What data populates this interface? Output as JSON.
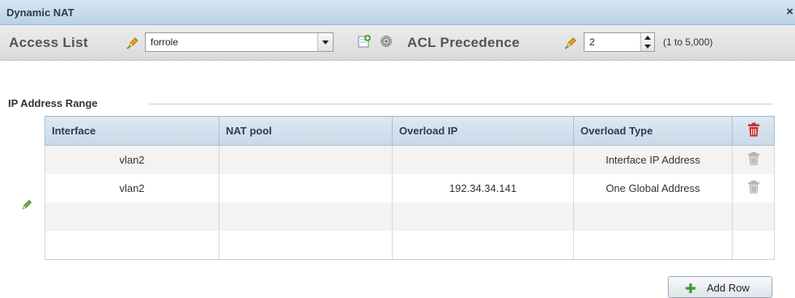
{
  "window": {
    "title": "Dynamic NAT",
    "close_glyph": "×"
  },
  "toolbar": {
    "access_list_label": "Access List",
    "access_list_value": "forrole",
    "acl_precedence_label": "ACL Precedence",
    "acl_precedence_value": "2",
    "acl_precedence_range": "(1 to 5,000)",
    "icons": [
      "pencil-icon",
      "dropdown-arrow-icon",
      "create-new-icon",
      "gear-icon",
      "spinner-up-icon",
      "spinner-down-icon"
    ]
  },
  "section": {
    "title": "IP Address Range"
  },
  "table": {
    "headers": [
      "Interface",
      "NAT pool",
      "Overload IP",
      "Overload Type"
    ],
    "rows": [
      [
        "vlan2",
        "",
        "",
        "Interface IP Address"
      ],
      [
        "vlan2",
        "",
        "192.34.34.141",
        "One Global Address"
      ],
      [
        "",
        "",
        "",
        ""
      ],
      [
        "",
        "",
        "",
        ""
      ]
    ]
  },
  "add_row_label": "Add Row",
  "colors": {
    "header_bg": "#c8d9e8",
    "delete_red": "#cc2a2a",
    "add_green": "#3a9a2e"
  }
}
